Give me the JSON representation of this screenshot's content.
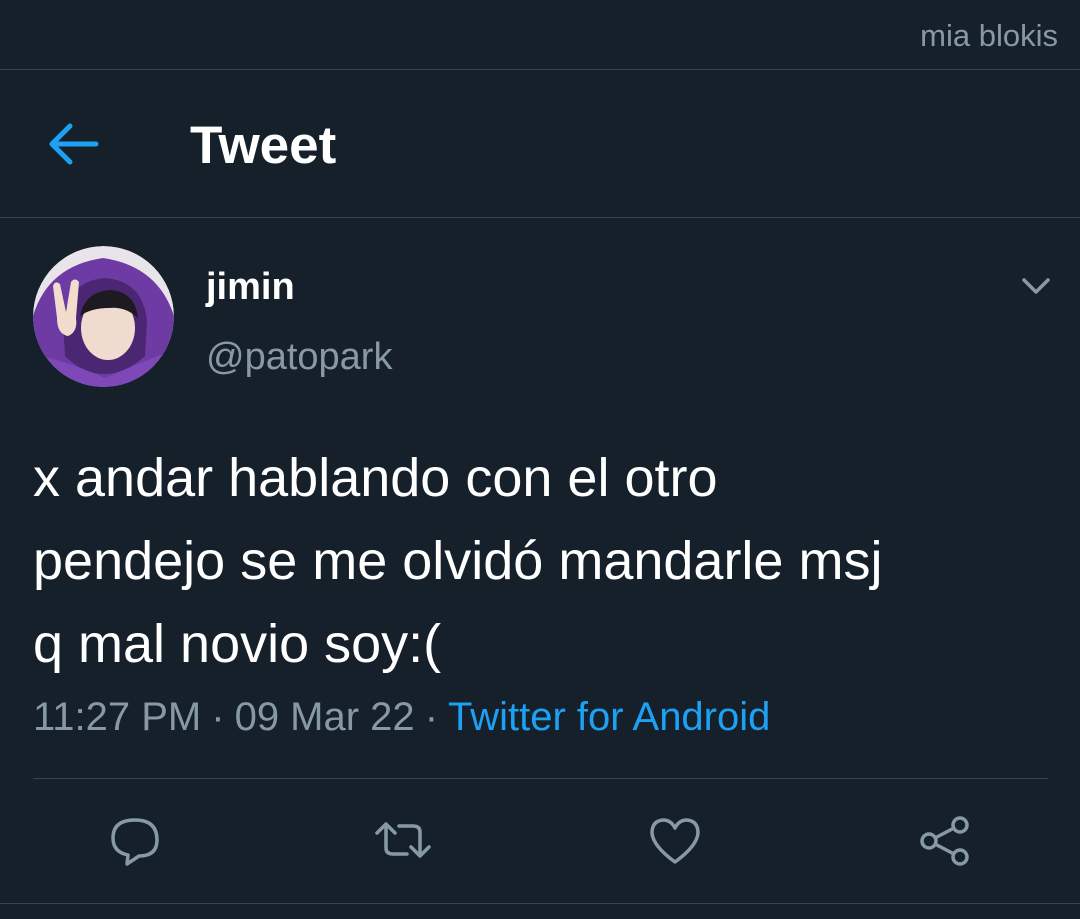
{
  "watermark": "mia blokis",
  "header": {
    "title": "Tweet",
    "back_icon": "arrow-left-icon"
  },
  "tweet": {
    "display_name": "jimin",
    "handle": "@patopark",
    "text_lines": [
      "x andar hablando con el otro",
      "pendejo se me olvidó mandarle msj",
      "q mal novio soy:("
    ],
    "time": "11:27 PM",
    "date": "09 Mar 22",
    "separator": "·",
    "source": "Twitter for Android"
  },
  "actions": {
    "reply_icon": "reply-icon",
    "retweet_icon": "retweet-icon",
    "like_icon": "heart-icon",
    "share_icon": "share-icon"
  },
  "colors": {
    "background": "#15202b",
    "border": "#38444d",
    "muted": "#8899a6",
    "accent": "#1da1f2"
  }
}
